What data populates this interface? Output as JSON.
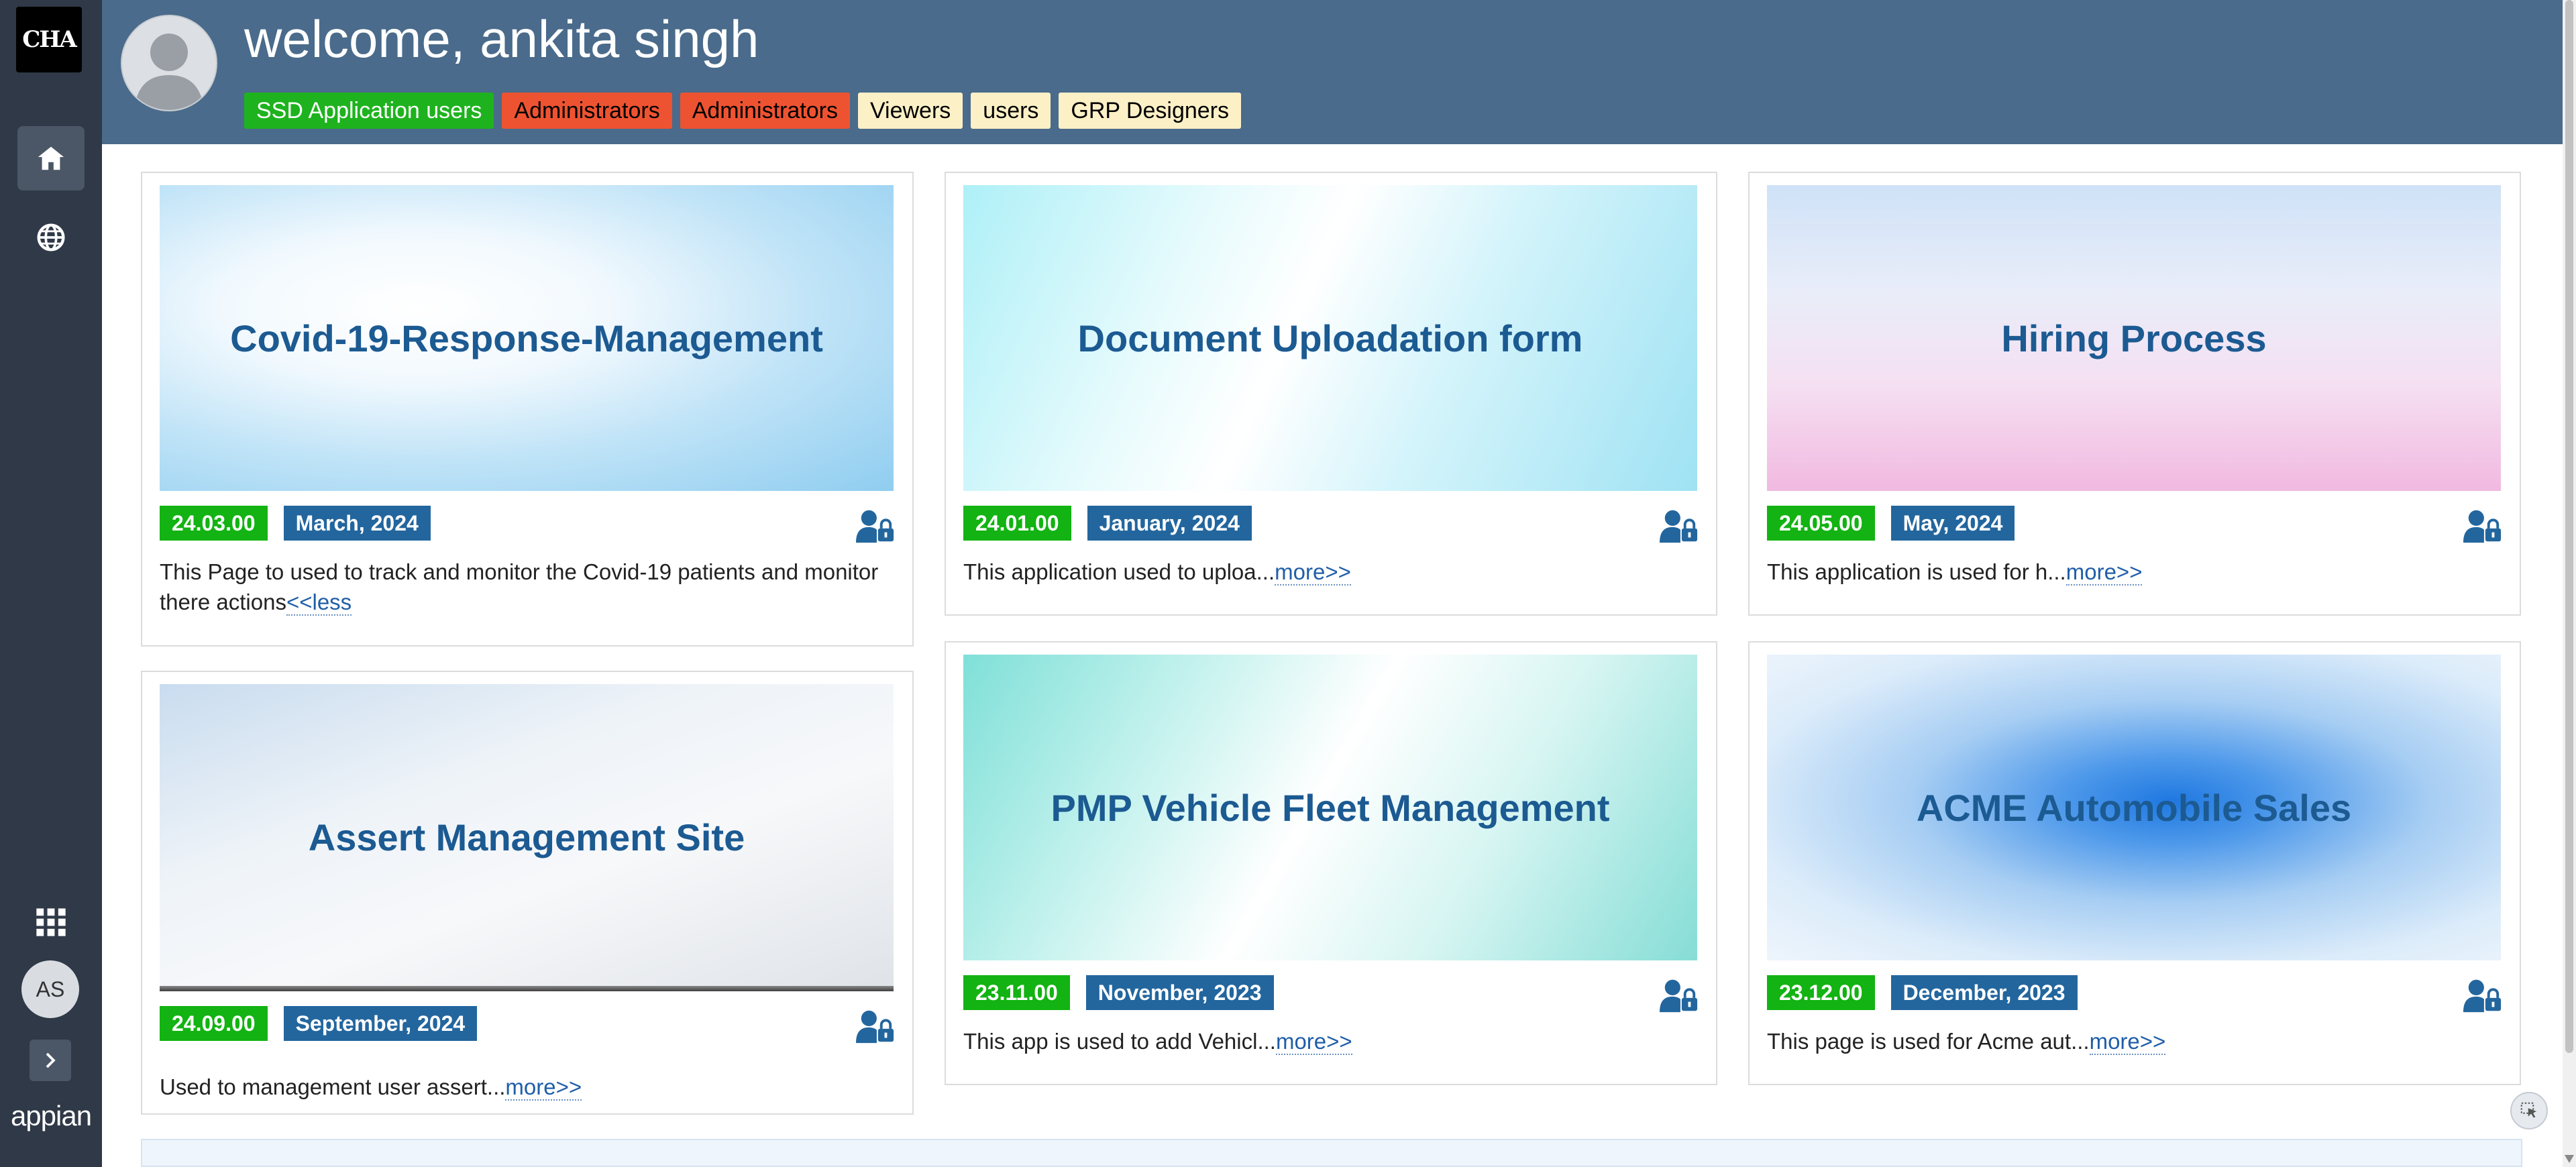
{
  "nav": {
    "logo_text": "CHA",
    "items": [
      {
        "icon": "home-icon",
        "active": true
      },
      {
        "icon": "globe-icon",
        "active": false
      }
    ],
    "user_initials": "AS",
    "brand": "appian"
  },
  "header": {
    "welcome": "welcome, ankita singh",
    "groups": [
      {
        "label": "SSD Application users",
        "color": "#1eb31e"
      },
      {
        "label": "Administrators",
        "color": "#ee5331"
      },
      {
        "label": "Administrators",
        "color": "#ee5331"
      },
      {
        "label": "Viewers",
        "color": "#fcf0c6"
      },
      {
        "label": "users",
        "color": "#fcf0c6"
      },
      {
        "label": "GRP Designers",
        "color": "#fcf0c6"
      }
    ]
  },
  "cards": [
    {
      "title": "Covid-19-Response-Management",
      "version": "24.03.00",
      "date": "March, 2024",
      "desc": "This Page to used to track and monitor the Covid-19 patients and monitor there actions",
      "link": "<<less"
    },
    {
      "title": "Document Uploadation form",
      "version": "24.01.00",
      "date": "January, 2024",
      "desc": "This application used to uploa...",
      "link": "more>>"
    },
    {
      "title": "Hiring Process",
      "version": "24.05.00",
      "date": "May, 2024",
      "desc": "This application is used for h...",
      "link": "more>>"
    },
    {
      "title": "Assert Management Site",
      "version": "24.09.00",
      "date": "September, 2024",
      "desc": "Used to management user assert...",
      "link": "more>>"
    },
    {
      "title": "PMP Vehicle Fleet Management",
      "version": "23.11.00",
      "date": "November, 2023",
      "desc": "This app is used to add Vehicl...",
      "link": "more>>"
    },
    {
      "title": "ACME Automobile Sales",
      "version": "23.12.00",
      "date": "December, 2023",
      "desc": "This page is used for Acme aut...",
      "link": "more>>"
    }
  ],
  "colors": {
    "header_bg": "#4a6b8b",
    "rail_bg": "#2f3947",
    "version_badge": "#12b312",
    "date_badge": "#23669e",
    "title_color": "#1c5a92"
  }
}
